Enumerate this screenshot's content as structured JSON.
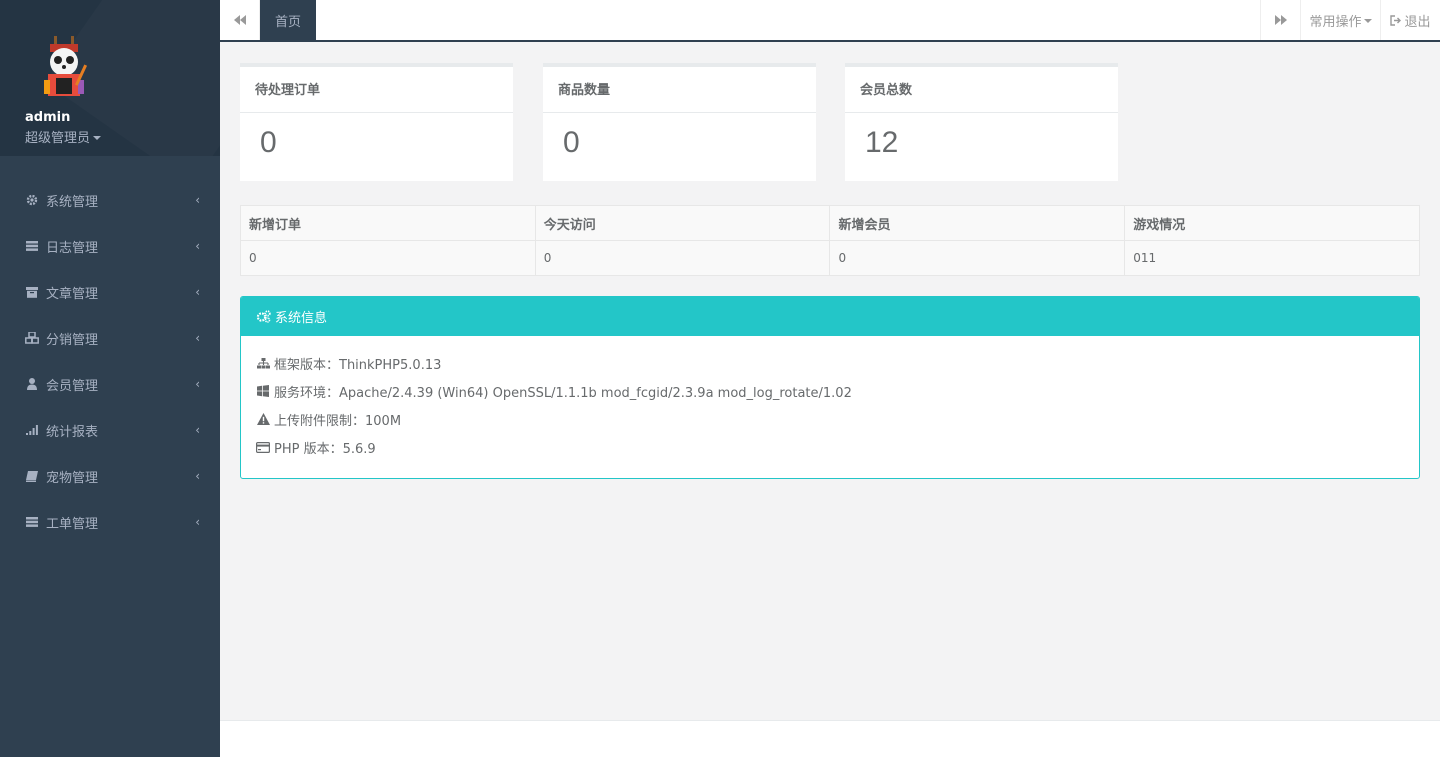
{
  "profile": {
    "name": "admin",
    "role": "超级管理员"
  },
  "sidebar": {
    "items": [
      {
        "label": "系统管理",
        "icon": "gear-icon"
      },
      {
        "label": "日志管理",
        "icon": "server-icon"
      },
      {
        "label": "文章管理",
        "icon": "archive-icon"
      },
      {
        "label": "分销管理",
        "icon": "cubes-icon"
      },
      {
        "label": "会员管理",
        "icon": "user-icon"
      },
      {
        "label": "统计报表",
        "icon": "signal-icon"
      },
      {
        "label": "宠物管理",
        "icon": "book-icon"
      },
      {
        "label": "工单管理",
        "icon": "server-icon"
      }
    ],
    "arrow": "‹"
  },
  "topbar": {
    "active_tab": "首页",
    "ops_label": "常用操作",
    "logout_label": "退出"
  },
  "stats": [
    {
      "title": "待处理订单",
      "value": "0"
    },
    {
      "title": "商品数量",
      "value": "0"
    },
    {
      "title": "会员总数",
      "value": "12"
    }
  ],
  "table": {
    "headers": [
      "新增订单",
      "今天访问",
      "新增会员",
      "游戏情况"
    ],
    "row": [
      "0",
      "0",
      "0",
      "011"
    ]
  },
  "system_panel": {
    "title": "系统信息",
    "lines": [
      {
        "icon": "sitemap-icon",
        "text": "框架版本：ThinkPHP5.0.13"
      },
      {
        "icon": "windows-icon",
        "text": "服务环境：Apache/2.4.39 (Win64) OpenSSL/1.1.1b mod_fcgid/2.3.9a mod_log_rotate/1.02"
      },
      {
        "icon": "warning-icon",
        "text": "上传附件限制：100M"
      },
      {
        "icon": "credit-card-icon",
        "text": "PHP 版本：5.6.9"
      }
    ]
  },
  "colors": {
    "sidebar_bg": "#2f4050",
    "profile_bg": "#243443",
    "accent_info": "#23c6c8",
    "content_bg": "#f3f3f4"
  }
}
